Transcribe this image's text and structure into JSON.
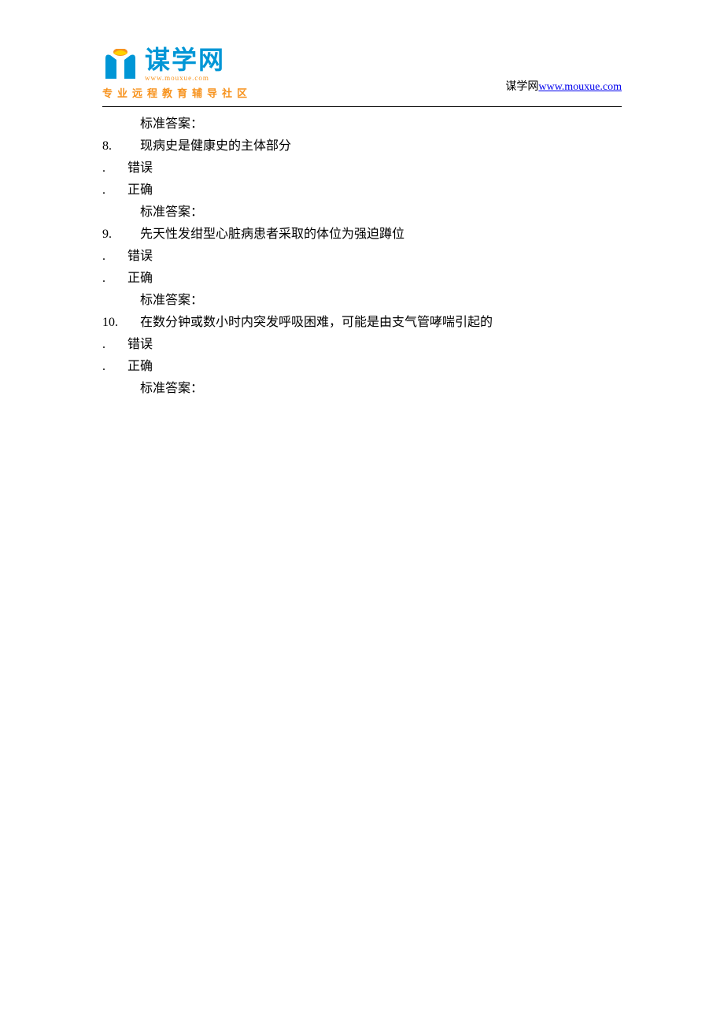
{
  "header": {
    "logo_chars": "谋学网",
    "logo_url": "www.mouxue.com",
    "tagline": "专业远程教育辅导社区",
    "right_text": "谋学网",
    "right_link": "www.mouxue.com"
  },
  "content": {
    "answer_label": "标准答案：",
    "option_wrong": "错误",
    "option_correct": "正确",
    "dot": ".",
    "questions": [
      {
        "num": "8.",
        "text": "现病史是健康史的主体部分"
      },
      {
        "num": "9.",
        "text": "先天性发绀型心脏病患者采取的体位为强迫蹲位"
      },
      {
        "num": "10.",
        "text": "在数分钟或数小时内突发呼吸困难，可能是由支气管哮喘引起的"
      }
    ]
  }
}
